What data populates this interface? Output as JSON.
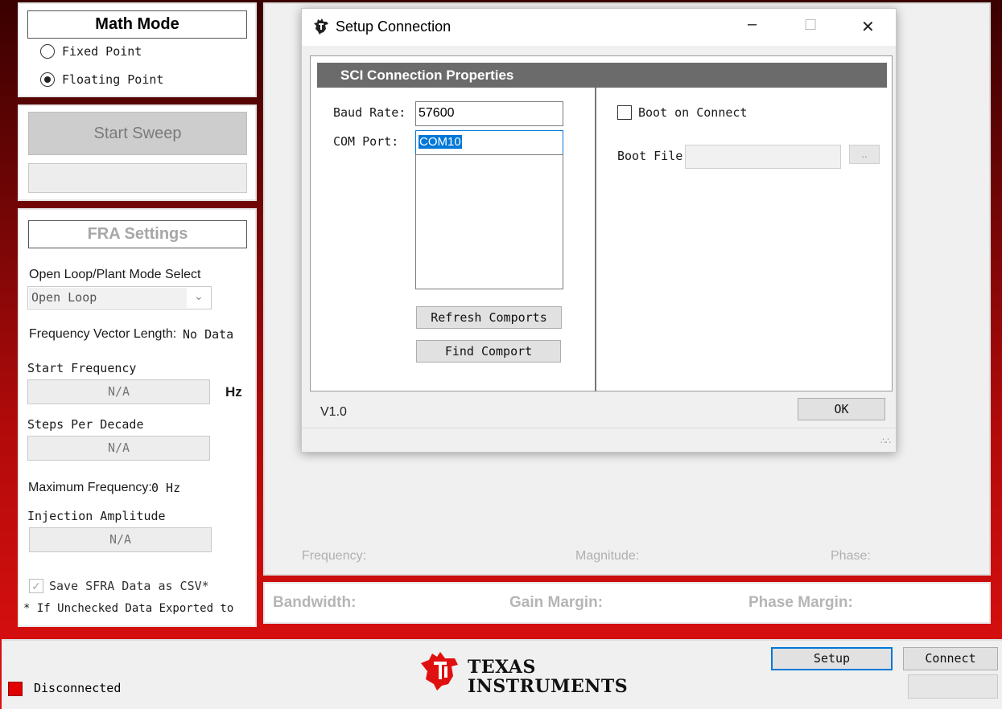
{
  "math_mode": {
    "title": "Math Mode",
    "options": [
      {
        "label": "Fixed Point",
        "selected": false
      },
      {
        "label": "Floating Point",
        "selected": true
      }
    ]
  },
  "sweep": {
    "start_label": "Start Sweep"
  },
  "fra": {
    "title": "FRA Settings",
    "mode_select_label": "Open Loop/Plant Mode Select",
    "mode_select_value": "Open Loop",
    "freq_vector_label": "Frequency Vector Length:",
    "freq_vector_value": "No Data",
    "start_freq_label": "Start Frequency",
    "start_freq_value": "N/A",
    "start_freq_unit": "Hz",
    "steps_label": "Steps Per Decade",
    "steps_value": "N/A",
    "max_freq_label": "Maximum Frequency:",
    "max_freq_value": "0 Hz",
    "inj_amp_label": "Injection Amplitude",
    "inj_amp_value": "N/A",
    "save_csv_label": "Save SFRA Data as CSV*",
    "save_csv_checked": true,
    "note": "* If Unchecked Data Exported to"
  },
  "plot": {
    "frequency_label": "Frequency:",
    "magnitude_label": "Magnitude:",
    "phase_label": "Phase:"
  },
  "metrics": {
    "bandwidth_label": "Bandwidth:",
    "gain_margin_label": "Gain Margin:",
    "phase_margin_label": "Phase Margin:"
  },
  "status": {
    "connection_text": "Disconnected",
    "indicator_color": "#e00000"
  },
  "footer": {
    "logo_line1": "Texas",
    "logo_line2": "Instruments",
    "setup_label": "Setup",
    "connect_label": "Connect",
    "brand_color": "#e01010"
  },
  "dialog": {
    "title": "Setup Connection",
    "title_icon": "ti-logo-icon",
    "controls": {
      "minimize": "–",
      "maximize": "☐",
      "close": "✕"
    },
    "section_title": "SCI Connection Properties",
    "baud_label": "Baud Rate:",
    "baud_value": "57600",
    "com_label": "COM Port:",
    "com_value": "COM10",
    "refresh_label": "Refresh Comports",
    "find_label": "Find Comport",
    "boot_on_connect_label": "Boot on Connect",
    "boot_on_connect_checked": false,
    "boot_file_label": "Boot File:",
    "boot_file_value": "",
    "browse_label": "..",
    "version": "V1.0",
    "ok_label": "OK"
  }
}
